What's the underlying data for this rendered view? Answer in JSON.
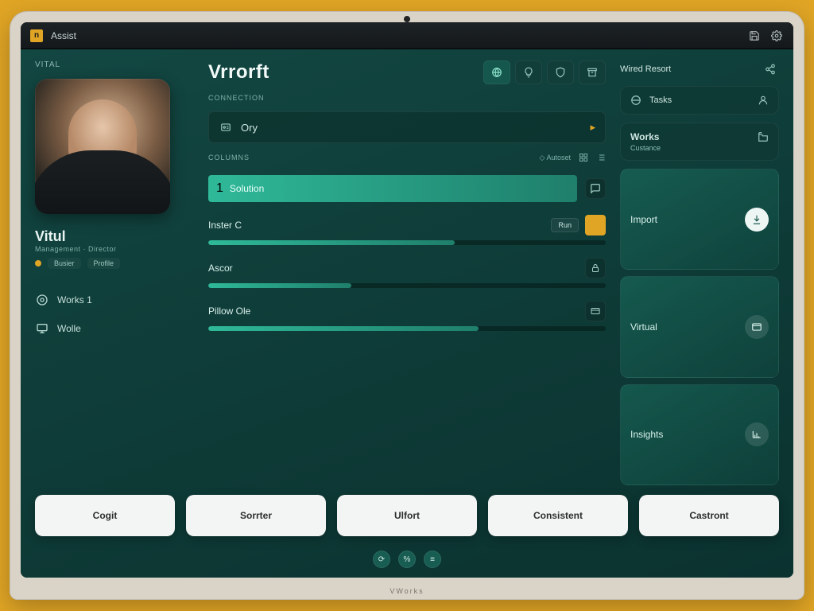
{
  "window": {
    "badge": "n",
    "title": "Assist"
  },
  "left": {
    "tag": "Vital",
    "user_name": "Vitul",
    "user_sub": "Management · Director",
    "status_a": "Busier",
    "status_b": "Profile",
    "nav": [
      {
        "label": "Works 1"
      },
      {
        "label": "Wolle"
      }
    ]
  },
  "center": {
    "title": "Vrrorft",
    "subtitle": "Connection",
    "dropdown": {
      "label": "Ory"
    },
    "column_label": "Columns",
    "meta_right": "Autoset",
    "items": [
      {
        "num": "1",
        "label": "Solution",
        "pct": 100,
        "trailing": "chat"
      },
      {
        "num": "",
        "label": "Inster C",
        "pct": 62,
        "trailing": "btns",
        "btn_label": "Run"
      },
      {
        "num": "",
        "label": "Ascor",
        "pct": 36,
        "trailing": "lock"
      },
      {
        "num": "",
        "label": "Pillow Ole",
        "pct": 68,
        "trailing": "card"
      }
    ]
  },
  "right": {
    "header": "Wired Resort",
    "card": {
      "label": "Tasks"
    },
    "panel_title": "Works",
    "panel_sub": "Custance",
    "tiles": [
      {
        "label": "Import"
      },
      {
        "label": "Virtual"
      },
      {
        "label": "Insights"
      }
    ]
  },
  "buttons": [
    "Cogit",
    "Sorrter",
    "Ulfort",
    "Consistent",
    "Castront"
  ],
  "footer_dots": [
    "⟳",
    "%",
    "≡"
  ],
  "brand": "VWorks"
}
